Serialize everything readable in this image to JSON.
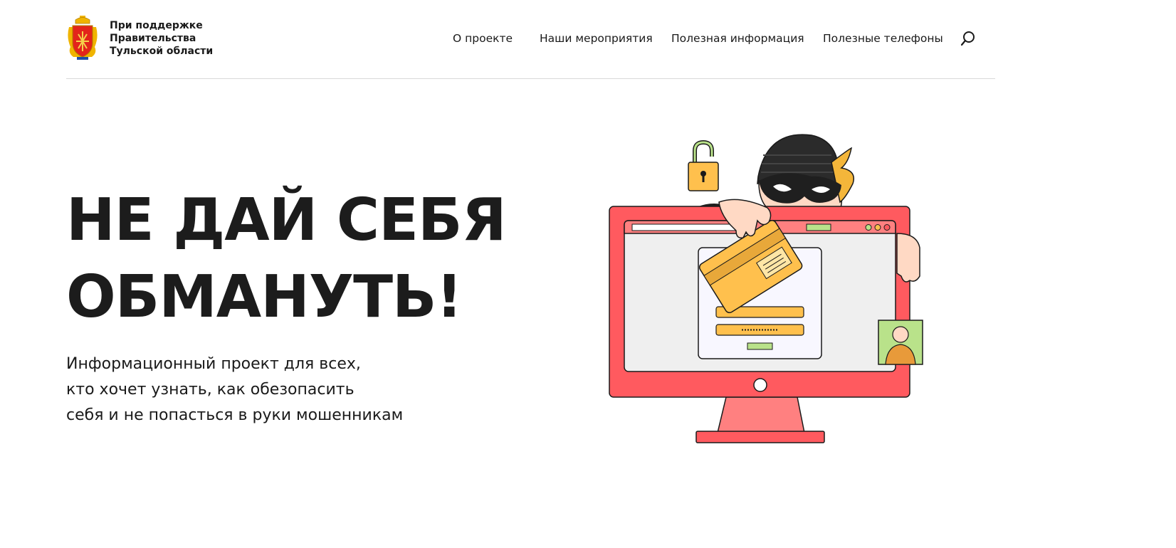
{
  "header": {
    "logo_icon": "tula-region-coat-of-arms-icon",
    "support_lines": [
      "При поддержке",
      "Правительства",
      "Тульской области"
    ],
    "nav": [
      {
        "label": "О проекте"
      },
      {
        "label": "Наши мероприятия"
      },
      {
        "label": "Полезная информация"
      },
      {
        "label": "Полезные телефоны"
      }
    ],
    "search_icon": "search-icon"
  },
  "hero": {
    "title_lines": [
      "НЕ ДАЙ СЕБЯ",
      "ОБМАНУТЬ!"
    ],
    "subtitle_lines": [
      "Информационный проект для всех,",
      "кто хочет узнать, как обезопасить",
      "себя и не попасться в руки мошенникам"
    ]
  },
  "illustration": {
    "icon": "thief-stealing-card-from-computer-illustration",
    "colors": {
      "monitor": "#ff5a5f",
      "card": "#ffc04d",
      "avatar_bg": "#b9e28a",
      "mask": "#222222"
    }
  }
}
